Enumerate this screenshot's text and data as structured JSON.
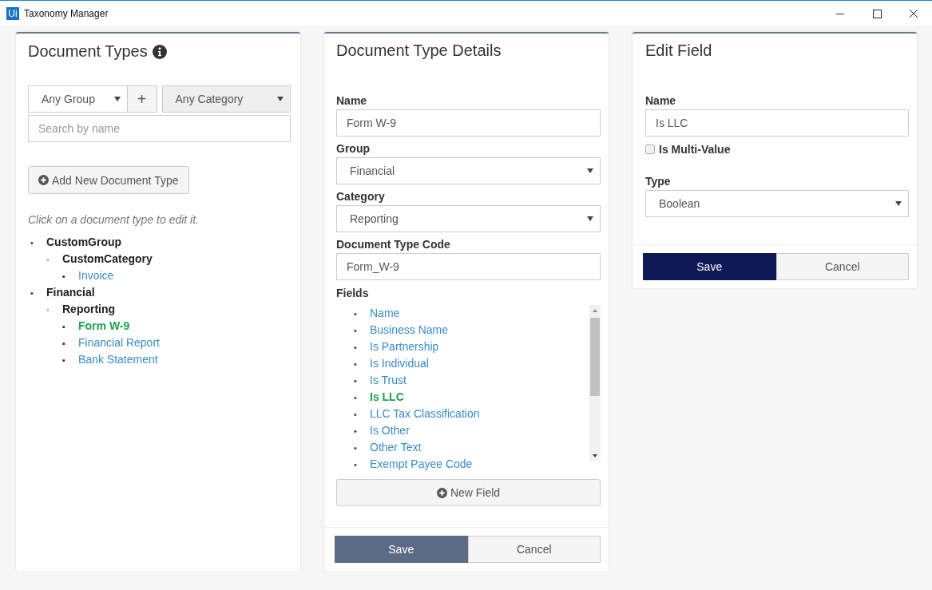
{
  "window": {
    "logo": "Ui",
    "title": "Taxonomy Manager"
  },
  "document_types": {
    "title": "Document Types",
    "group_select": {
      "value": "Any Group"
    },
    "add_group_button": "+",
    "category_select": {
      "value": "Any Category",
      "disabled": true
    },
    "search": {
      "placeholder": "Search by name"
    },
    "add_button": "Add New Document Type",
    "hint": "Click on a document type to edit it.",
    "tree": [
      {
        "bullet": "•",
        "label": "CustomGroup",
        "children": [
          {
            "bullet": "◦",
            "label": "CustomCategory",
            "children": [
              {
                "bullet": "▪",
                "label": "Invoice",
                "selected": false
              }
            ]
          }
        ]
      },
      {
        "bullet": "•",
        "label": "Financial",
        "children": [
          {
            "bullet": "◦",
            "label": "Reporting",
            "children": [
              {
                "bullet": "▪",
                "label": "Form W-9",
                "selected": true
              },
              {
                "bullet": "▪",
                "label": "Financial Report",
                "selected": false
              },
              {
                "bullet": "▪",
                "label": "Bank Statement",
                "selected": false
              }
            ]
          }
        ]
      }
    ]
  },
  "details": {
    "title": "Document Type Details",
    "form": [
      {
        "kind": "text",
        "label": "Name",
        "value": "Form W-9"
      },
      {
        "kind": "select",
        "label": "Group",
        "value": "Financial"
      },
      {
        "kind": "select",
        "label": "Category",
        "value": "Reporting"
      },
      {
        "kind": "text",
        "label": "Document Type Code",
        "value": "Form_W-9"
      }
    ],
    "fields_label": "Fields",
    "fields": [
      {
        "bullet": "•",
        "label": "Name",
        "selected": false
      },
      {
        "bullet": "•",
        "label": "Business Name",
        "selected": false
      },
      {
        "bullet": "•",
        "label": "Is Partnership",
        "selected": false
      },
      {
        "bullet": "•",
        "label": "Is Individual",
        "selected": false
      },
      {
        "bullet": "•",
        "label": "Is Trust",
        "selected": false
      },
      {
        "bullet": "•",
        "label": "Is LLC",
        "selected": true
      },
      {
        "bullet": "•",
        "label": "LLC Tax Classification",
        "selected": false
      },
      {
        "bullet": "•",
        "label": "Is Other",
        "selected": false
      },
      {
        "bullet": "•",
        "label": "Other Text",
        "selected": false
      },
      {
        "bullet": "•",
        "label": "Exempt Payee Code",
        "selected": false
      }
    ],
    "new_field_button": "New Field",
    "save_button": {
      "label": "Save",
      "focused": false
    },
    "cancel_button": "Cancel"
  },
  "edit_field": {
    "title": "Edit Field",
    "name_label": "Name",
    "name_value": "Is LLC",
    "multi_value": {
      "label": "Is Multi-Value",
      "checked": false
    },
    "type_label": "Type",
    "type_value": "Boolean",
    "save_button": {
      "label": "Save",
      "focused": true
    },
    "cancel_button": "Cancel"
  }
}
